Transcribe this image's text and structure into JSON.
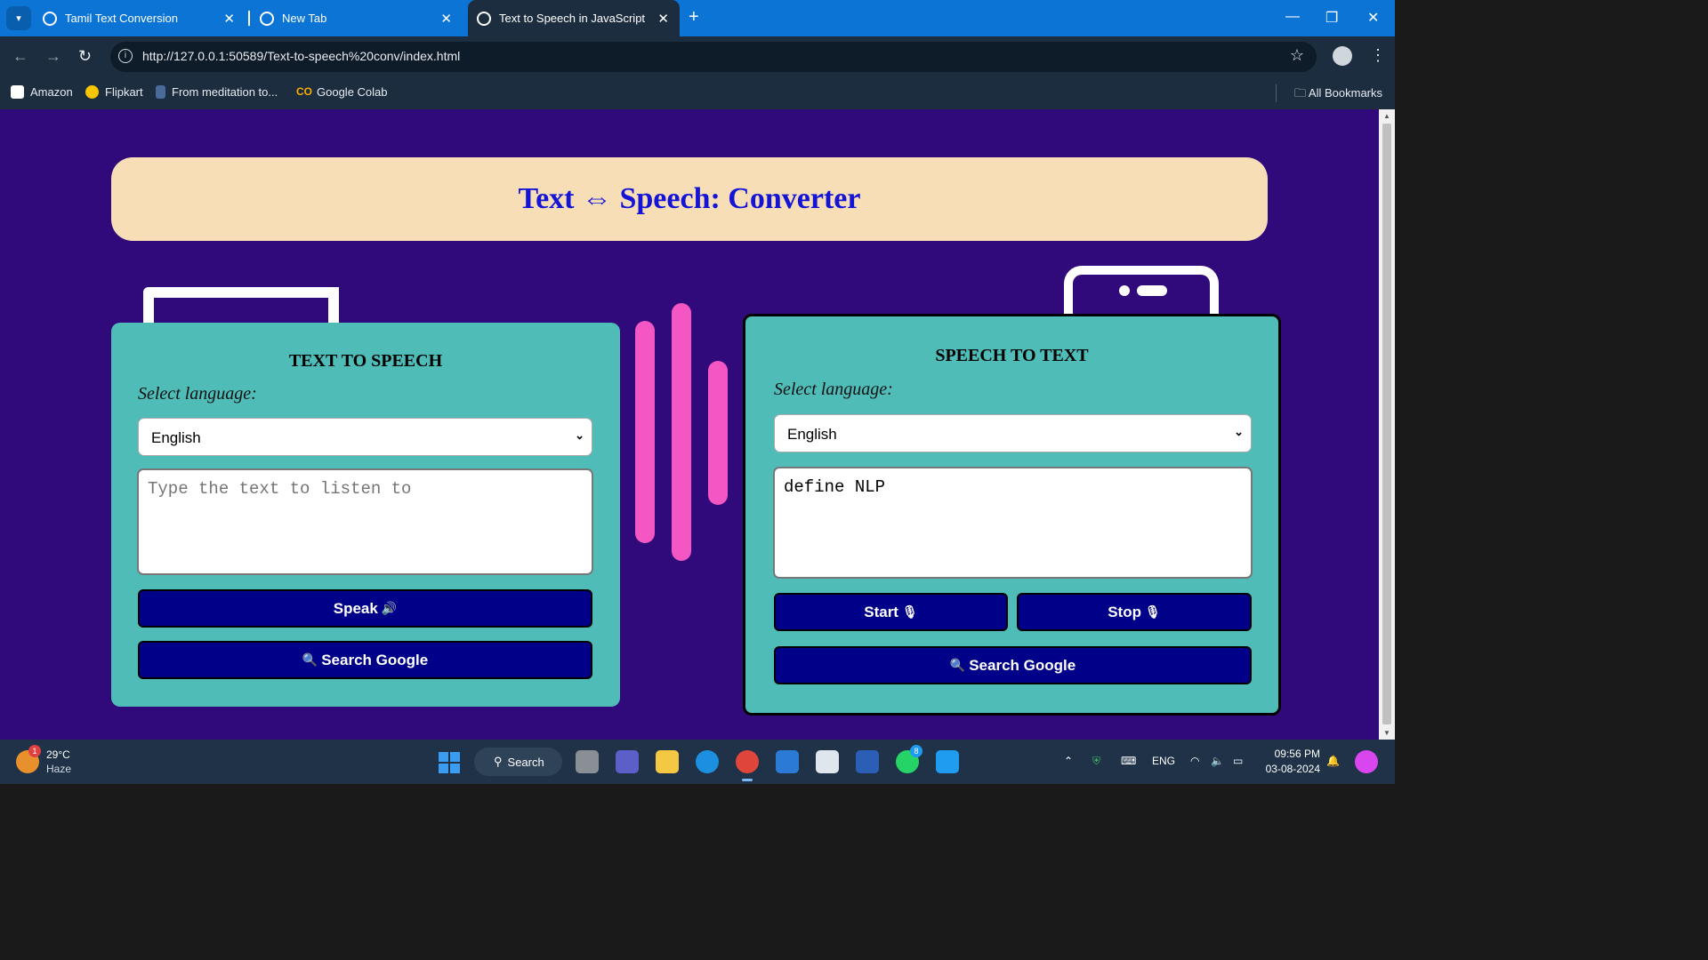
{
  "browser": {
    "tabs": [
      {
        "title": "Tamil Text Conversion",
        "active": false
      },
      {
        "title": "New Tab",
        "active": false
      },
      {
        "title": "Text to Speech in JavaScript",
        "active": true
      }
    ],
    "url": "http://127.0.0.1:50589/Text-to-speech%20conv/index.html",
    "bookmarks": [
      "Amazon",
      "Flipkart",
      "From meditation to...",
      "Google Colab"
    ],
    "all_bookmarks_label": "All Bookmarks"
  },
  "page": {
    "title": "Text ⇔ Speech: Converter",
    "tts": {
      "heading": "TEXT TO SPEECH",
      "language_label": "Select language:",
      "language_value": "English",
      "textarea_placeholder": "Type the text to listen to",
      "speak_label": "Speak",
      "search_label": "Search Google"
    },
    "stt": {
      "heading": "SPEECH TO TEXT",
      "language_label": "Select language:",
      "language_value": "English",
      "textarea_value": "define NLP",
      "start_label": "Start",
      "stop_label": "Stop",
      "search_label": "Search Google"
    }
  },
  "taskbar": {
    "weather_temp": "29°C",
    "weather_cond": "Haze",
    "weather_badge": "1",
    "search_label": "Search",
    "whatsapp_badge": "8",
    "lang": "ENG",
    "time": "09:56 PM",
    "date": "03-08-2024"
  },
  "colors": {
    "page_bg": "#300a7a",
    "banner_bg": "#f7deb6",
    "title_color": "#1414d6",
    "panel_bg": "#4fbcb8",
    "button_bg": "#000088",
    "accent_bars": "#f456c3"
  }
}
